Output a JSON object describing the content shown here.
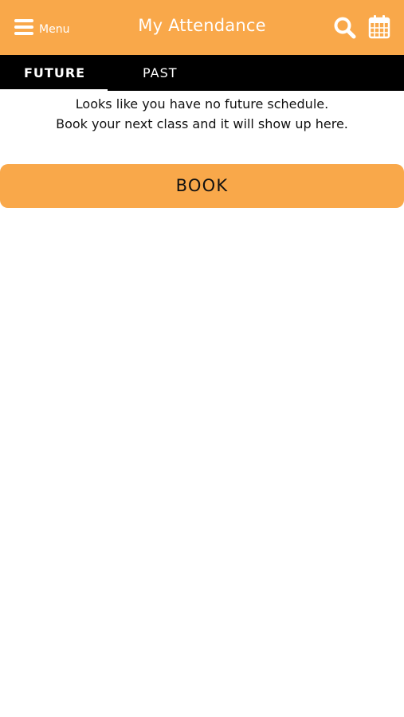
{
  "colors": {
    "accent": "#f9a84a",
    "tabbar": "#000000",
    "text": "#111111",
    "header_text": "#ffffff"
  },
  "header": {
    "menu_label": "Menu",
    "title": "My Attendance",
    "search_icon": "search-icon",
    "calendar_icon": "calendar-icon",
    "menu_icon": "hamburger-menu-icon"
  },
  "tabs": [
    {
      "label": "FUTURE",
      "active": true
    },
    {
      "label": "PAST",
      "active": false
    }
  ],
  "empty_state": {
    "line1": "Looks like you have no future schedule.",
    "line2": "Book your next class and it will show up here."
  },
  "book_button": {
    "label": "BOOK"
  }
}
